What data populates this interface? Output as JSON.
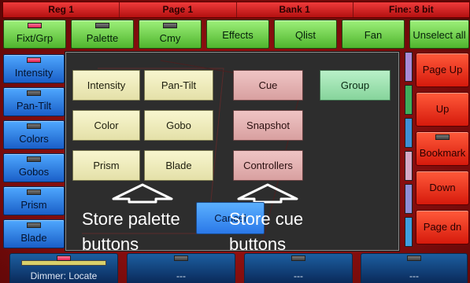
{
  "status_bar": [
    "Reg 1",
    "Page 1",
    "Bank 1",
    "Fine: 8 bit"
  ],
  "top_buttons": [
    {
      "label": "Fixt/Grp",
      "led": "red"
    },
    {
      "label": "Palette",
      "led": "gray"
    },
    {
      "label": "Cmy",
      "led": "gray"
    },
    {
      "label": "Effects",
      "led": "none"
    },
    {
      "label": "Qlist",
      "led": "none"
    },
    {
      "label": "Fan",
      "led": "none"
    },
    {
      "label": "Unselect all",
      "led": "none"
    }
  ],
  "left_buttons": [
    {
      "label": "Intensity",
      "led": "red"
    },
    {
      "label": "Pan-Tilt",
      "led": "gray"
    },
    {
      "label": "Colors",
      "led": "gray"
    },
    {
      "label": "Gobos",
      "led": "gray"
    },
    {
      "label": "Prism",
      "led": "gray"
    },
    {
      "label": "Blade",
      "led": "gray"
    }
  ],
  "right_buttons": [
    {
      "label": "Page Up"
    },
    {
      "label": "Up"
    },
    {
      "label": "Bookmark",
      "led": "gray"
    },
    {
      "label": "Down"
    },
    {
      "label": "Page dn"
    }
  ],
  "color_strip": [
    "#a98ad6",
    "#3fae5c",
    "#3f8fd6",
    "#d6a9c6",
    "#8f8fd6",
    "#3f9fe0"
  ],
  "dialog": {
    "palette_buttons": [
      "Intensity",
      "Pan-Tilt",
      "Color",
      "Gobo",
      "Prism",
      "Blade"
    ],
    "cue_buttons": [
      "Cue",
      "Snapshot",
      "Controllers"
    ],
    "group_button": "Group",
    "cancel_label": "Cancel"
  },
  "annotations": {
    "store_palette": "Store palette",
    "store_palette_2": "buttons",
    "store_cue": "Store cue",
    "store_cue_2": "buttons"
  },
  "encoders": [
    {
      "label": "Dimmer: Locate",
      "led": "red",
      "has_bar": true
    },
    {
      "label": "---",
      "led": "gray",
      "has_bar": false
    },
    {
      "label": "---",
      "led": "gray",
      "has_bar": false
    },
    {
      "label": "---",
      "led": "gray",
      "has_bar": false
    }
  ]
}
